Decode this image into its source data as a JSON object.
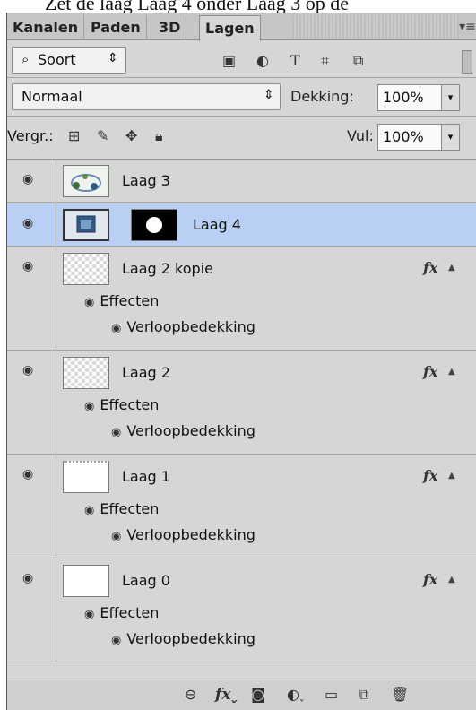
{
  "header_fragment": "Zet de laag Laag 4 onder Laag 3 op de",
  "tabs": [
    {
      "label": "Kanalen",
      "active": false
    },
    {
      "label": "Paden",
      "active": false
    },
    {
      "label": "3D",
      "active": false
    },
    {
      "label": "Lagen",
      "active": true
    }
  ],
  "panel_menu_icon": "panel-menu-icon",
  "filter": {
    "kind_label": "Soort",
    "kind_icon": "search-icon",
    "icons": [
      "image-filter-icon",
      "adjustment-filter-icon",
      "type-filter-icon",
      "shape-filter-icon",
      "smart-object-filter-icon"
    ]
  },
  "blend": {
    "mode": "Normaal",
    "opacity_label": "Dekking:",
    "opacity_value": "100%"
  },
  "lock": {
    "label": "Vergr.:",
    "icons": [
      "lock-transparent-icon",
      "lock-image-icon",
      "lock-position-icon",
      "lock-all-icon"
    ],
    "fill_label": "Vul:",
    "fill_value": "100%"
  },
  "layers": [
    {
      "name": "Laag 3",
      "visible": true,
      "selected": false,
      "fx": false,
      "thumbnail": "photo-icon",
      "effects": []
    },
    {
      "name": "Laag 4",
      "visible": true,
      "selected": true,
      "fx": false,
      "thumbnail": "photo-icon",
      "mask": "layer-mask-icon",
      "effects": []
    },
    {
      "name": "Laag 2 kopie",
      "visible": true,
      "selected": false,
      "fx": true,
      "thumbnail": "transparent",
      "effects_label": "Effecten",
      "effects": [
        "Verloopbedekking"
      ]
    },
    {
      "name": "Laag 2",
      "visible": true,
      "selected": false,
      "fx": true,
      "thumbnail": "transparent",
      "effects_label": "Effecten",
      "effects": [
        "Verloopbedekking"
      ]
    },
    {
      "name": "Laag 1",
      "visible": true,
      "selected": false,
      "fx": true,
      "thumbnail": "white",
      "effects_label": "Effecten",
      "effects": [
        "Verloopbedekking"
      ]
    },
    {
      "name": "Laag 0",
      "visible": true,
      "selected": false,
      "fx": true,
      "thumbnail": "white",
      "effects_label": "Effecten",
      "effects": [
        "Verloopbedekking"
      ]
    }
  ],
  "fx_label": "fx",
  "bottom_toolbar": [
    "link-layers-icon",
    "add-layer-style-icon",
    "add-mask-icon",
    "adjustment-layer-icon",
    "new-group-icon",
    "new-layer-icon",
    "delete-icon"
  ],
  "colors": {
    "selected_row": "#b9cff3",
    "panel_bg": "#d6d6d6"
  }
}
